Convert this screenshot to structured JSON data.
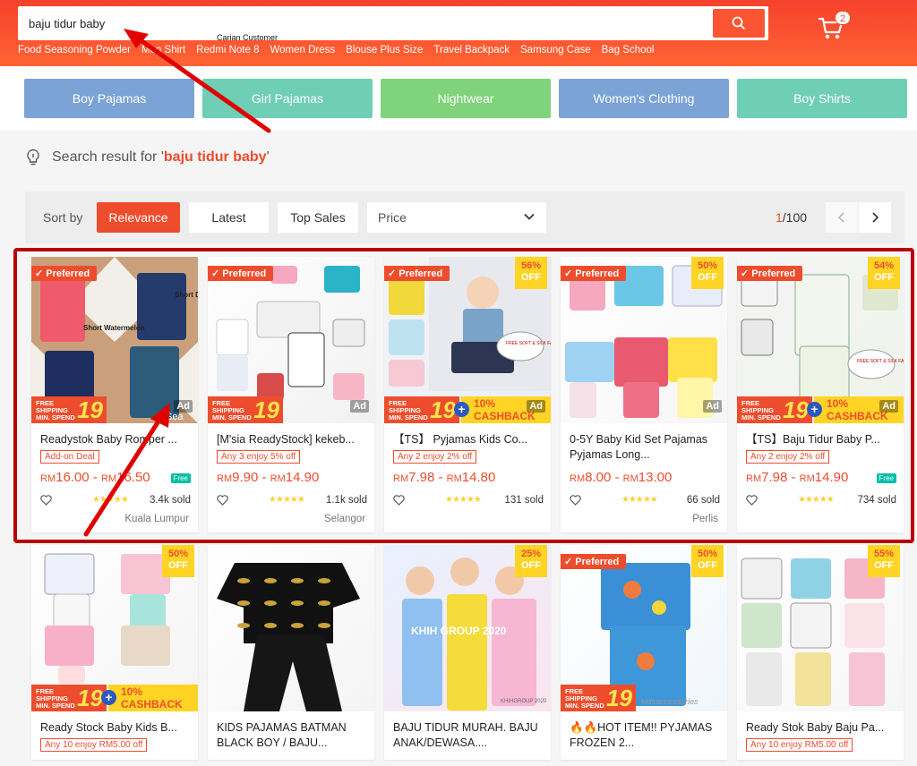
{
  "search": {
    "value": "baju tidur baby",
    "hint": "Carian Customer"
  },
  "cart": {
    "count": "2"
  },
  "keywords": [
    "Food Seasoning Powder",
    "Men Shirt",
    "Redmi Note 8",
    "Women Dress",
    "Blouse Plus Size",
    "Travel Backpack",
    "Samsung Case",
    "Bag School"
  ],
  "categories": [
    {
      "label": "Boy Pajamas",
      "color": "#7ba3d6"
    },
    {
      "label": "Girl Pajamas",
      "color": "#6fcfb4"
    },
    {
      "label": "Nightwear",
      "color": "#7fd37a"
    },
    {
      "label": "Women's Clothing",
      "color": "#7ba3d6"
    },
    {
      "label": "Boy Shirts",
      "color": "#6fcfb4"
    }
  ],
  "result": {
    "prefix": "Search result for '",
    "keyword": "baju tidur baby",
    "suffix": "'"
  },
  "sort": {
    "label": "Sort by",
    "relevance": "Relevance",
    "latest": "Latest",
    "top_sales": "Top Sales",
    "price": "Price"
  },
  "pager": {
    "current": "1",
    "total": "/100"
  },
  "badges": {
    "preferred": "Preferred",
    "ad": "Ad",
    "off": "OFF",
    "free_shipping": "FREE\nSHIPPING\nMIN. SPEND",
    "free_num": "19",
    "cashback": "10% CASHBACK",
    "free": "Free"
  },
  "products": [
    {
      "name": "Readystok Baby Romper ...",
      "promo": "Add-on Deal",
      "price_from": "16.00",
      "price_to": "16.50",
      "currency": "RM",
      "sold": "3.4k sold",
      "location": "Kuala Lumpur",
      "discount": "",
      "img_text": [
        "Short Watermelon",
        "Short Dino"
      ],
      "watermark": "Sea"
    },
    {
      "name": "[M'sia ReadyStock] kekeb...",
      "promo": "Any 3 enjoy 5% off",
      "price_from": "9.90",
      "price_to": "14.90",
      "currency": "RM",
      "sold": "1.1k sold",
      "location": "Selangor",
      "discount": ""
    },
    {
      "name": "【TS】 Pyjamas Kids Co...",
      "promo": "Any 2 enjoy 2% off",
      "price_from": "7.98",
      "price_to": "14.80",
      "currency": "RM",
      "sold": "131 sold",
      "location": "",
      "discount": "56%",
      "bubble": "FREE SOFT & SILK FABRIC"
    },
    {
      "name": "0-5Y Baby Kid Set Pajamas Pyjamas Long...",
      "promo": "",
      "price_from": "8.00",
      "price_to": "13.00",
      "currency": "RM",
      "sold": "66 sold",
      "location": "Perlis",
      "discount": "50%"
    },
    {
      "name": "【TS】Baju Tidur Baby P...",
      "promo": "Any 2 enjoy 2% off",
      "price_from": "7.98",
      "price_to": "14.90",
      "currency": "RM",
      "sold": "734 sold",
      "location": "",
      "discount": "54%",
      "bubble": "FREE SOFT & SILK FABRIC"
    },
    {
      "name": "Ready Stock Baby Kids B...",
      "promo": "Any 10 enjoy RM5.00 off",
      "discount": "50%"
    },
    {
      "name": "KIDS PAJAMAS BATMAN BLACK BOY / BAJU...",
      "promo": "",
      "discount": ""
    },
    {
      "name": "BAJU TIDUR MURAH. BAJU ANAK/DEWASA....",
      "promo": "",
      "discount": "25%",
      "img_text": [
        "KHIH GROUP 2020",
        "KHIHGROUP 2020"
      ]
    },
    {
      "name": "🔥🔥HOT ITEM!! PYJAMAS FROZEN 2...",
      "promo": "",
      "discount": "50%",
      "watermark": "kidsaccessories"
    },
    {
      "name": "Ready Stok Baby Baju Pa...",
      "promo": "Any 10 enjoy RM5.00 off",
      "discount": "55%"
    }
  ]
}
